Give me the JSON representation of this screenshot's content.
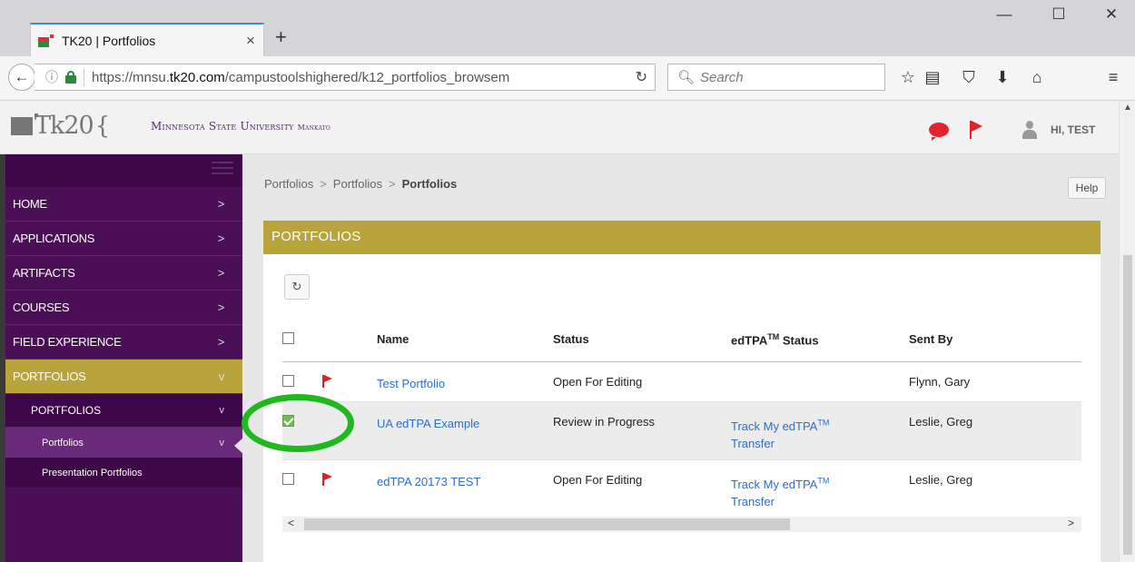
{
  "browser": {
    "tab_title": "TK20 | Portfolios",
    "tab_close": "×",
    "new_tab": "+",
    "minimize": "—",
    "maximize": "☐",
    "close": "✕",
    "url_prefix": "https://mnsu.",
    "url_host": "tk20.com",
    "url_path": "/campustoolshighered/k12_portfolios_browsem",
    "search_placeholder": "Search"
  },
  "header": {
    "logo_text": "Tk20",
    "logo_brace": "{",
    "university_main": "Minnesota State University",
    "university_sub": "Mankato",
    "greeting": "HI, TEST"
  },
  "sidebar": {
    "items": [
      {
        "label": "HOME",
        "chev": ">"
      },
      {
        "label": "APPLICATIONS",
        "chev": ">"
      },
      {
        "label": "ARTIFACTS",
        "chev": ">"
      },
      {
        "label": "COURSES",
        "chev": ">"
      },
      {
        "label": "FIELD EXPERIENCE",
        "chev": ">"
      },
      {
        "label": "PORTFOLIOS",
        "chev": "v"
      }
    ],
    "sub": {
      "label": "PORTFOLIOS",
      "chev": "v"
    },
    "sub2": [
      {
        "label": "Portfolios",
        "chev": "v"
      },
      {
        "label": "Presentation Portfolios"
      }
    ]
  },
  "content": {
    "breadcrumb": [
      "Portfolios",
      "Portfolios",
      "Portfolios"
    ],
    "breadcrumb_sep": ">",
    "help_label": "Help",
    "panel_title": "PORTFOLIOS",
    "refresh_glyph": "↻",
    "columns": {
      "name": "Name",
      "status": "Status",
      "edtpa_prefix": "edTPA",
      "tm": "TM",
      "edtpa_suffix": " Status",
      "sent_by": "Sent By"
    },
    "rows": [
      {
        "name": "Test Portfolio",
        "status": "Open For Editing",
        "edtpa_link_a": "",
        "edtpa_tm": "",
        "edtpa_link_b": "",
        "sent_by": "Flynn, Gary",
        "flag": true,
        "checked": false
      },
      {
        "name": "UA edTPA Example",
        "status": "Review in Progress",
        "edtpa_link_a": "Track My edTPA",
        "edtpa_tm": "TM",
        "edtpa_link_b": "Transfer",
        "sent_by": "Leslie, Greg",
        "flag": false,
        "checked": true
      },
      {
        "name": "edTPA 20173 TEST",
        "status": "Open For Editing",
        "edtpa_link_a": "Track My edTPA",
        "edtpa_tm": "TM",
        "edtpa_link_b": "Transfer",
        "sent_by": "Leslie, Greg",
        "flag": true,
        "checked": false
      }
    ],
    "scroll_left": "<",
    "scroll_right": ">"
  },
  "colors": {
    "sidebar_bg": "#4b0f58",
    "accent_gold": "#b9a33b",
    "link_blue": "#2a6fc9",
    "highlight_green": "#1fb81f",
    "alert_red": "#e2222c"
  }
}
